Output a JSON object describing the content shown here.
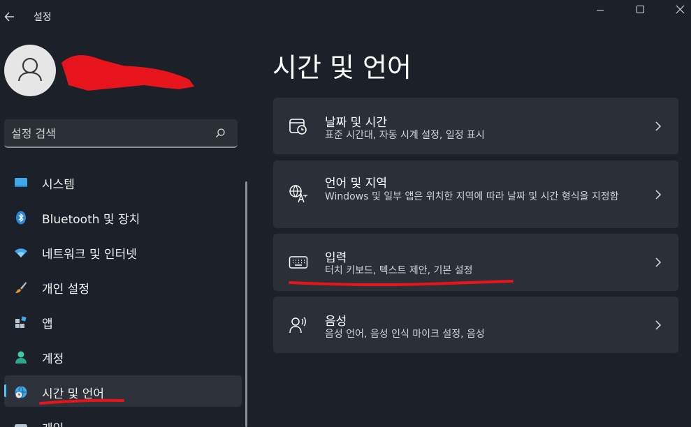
{
  "titlebar": {
    "app_title": "설정",
    "back_icon": "back-arrow-icon",
    "minimize_icon": "minimize-icon",
    "maximize_icon": "maximize-icon",
    "close_icon": "close-icon"
  },
  "search": {
    "placeholder": "설정 검색",
    "icon": "search-icon"
  },
  "sidebar": {
    "items": [
      {
        "label": "시스템",
        "icon": "display-icon"
      },
      {
        "label": "Bluetooth 및 장치",
        "icon": "bluetooth-icon"
      },
      {
        "label": "네트워크 및 인터넷",
        "icon": "wifi-icon"
      },
      {
        "label": "개인 설정",
        "icon": "paintbrush-icon"
      },
      {
        "label": "앱",
        "icon": "apps-icon"
      },
      {
        "label": "계정",
        "icon": "account-icon"
      },
      {
        "label": "시간 및 언어",
        "icon": "globe-clock-icon",
        "selected": true
      },
      {
        "label": "게임",
        "icon": "gamepad-icon"
      }
    ]
  },
  "main": {
    "title": "시간 및 언어",
    "cards": [
      {
        "title": "날짜 및 시간",
        "subtitle": "표준 시간대, 자동 시계 설정, 일정 표시",
        "icon": "calendar-clock-icon"
      },
      {
        "title": "언어 및 지역",
        "subtitle": "Windows 및 일부 앱은 위치한 지역에 따라 날짜 및 시간 형식을 지정함",
        "icon": "language-icon"
      },
      {
        "title": "입력",
        "subtitle": "터치 키보드, 텍스트 제안, 기본 설정",
        "icon": "keyboard-icon"
      },
      {
        "title": "음성",
        "subtitle": "음성 언어, 음성 인식 마이크 설정, 음성",
        "icon": "speech-icon"
      }
    ]
  },
  "colors": {
    "background": "#1c2028",
    "card": "#2b2f37",
    "accent": "#4cc2ff",
    "annotation_red": "#e8141c"
  }
}
